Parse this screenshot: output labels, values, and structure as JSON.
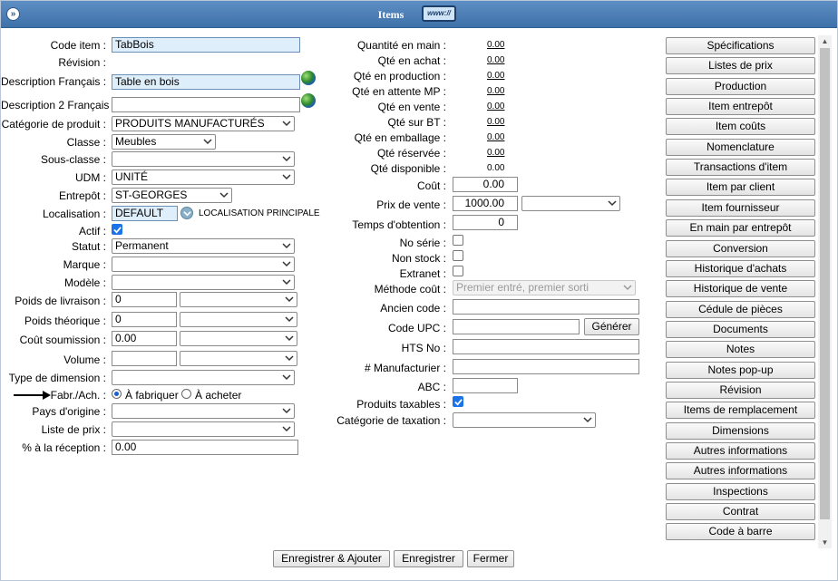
{
  "window": {
    "title": "Items",
    "badge": "www://",
    "menu_glyph": "»"
  },
  "left": {
    "code_item": {
      "label": "Code item :",
      "value": "TabBois"
    },
    "revision": {
      "label": "Révision :"
    },
    "description_fr": {
      "label": "Description Français :",
      "value": "Table en bois"
    },
    "description2_fr": {
      "label": "Description 2 Français :",
      "value": ""
    },
    "categorie": {
      "label": "Catégorie de produit :",
      "value": "PRODUITS MANUFACTURÉS"
    },
    "classe": {
      "label": "Classe :",
      "value": "Meubles"
    },
    "sous_classe": {
      "label": "Sous-classe :",
      "value": ""
    },
    "udm": {
      "label": "UDM :",
      "value": "UNITÉ"
    },
    "entrepot": {
      "label": "Entrepôt :",
      "value": "ST-GEORGES"
    },
    "localisation": {
      "label": "Localisation :",
      "value": "DEFAULT",
      "note": "LOCALISATION PRINCIPALE"
    },
    "actif": {
      "label": "Actif :",
      "checked": true
    },
    "statut": {
      "label": "Statut :",
      "value": "Permanent"
    },
    "marque": {
      "label": "Marque :",
      "value": ""
    },
    "modele": {
      "label": "Modèle :",
      "value": ""
    },
    "poids_livraison": {
      "label": "Poids de livraison :",
      "value": "0",
      "unit": ""
    },
    "poids_theorique": {
      "label": "Poids théorique :",
      "value": "0",
      "unit": ""
    },
    "cout_soumission": {
      "label": "Coût soumission :",
      "value": "0.00",
      "unit": ""
    },
    "volume": {
      "label": "Volume :",
      "value": "",
      "unit": ""
    },
    "type_dimension": {
      "label": "Type de dimension :",
      "value": ""
    },
    "fabr_ach": {
      "label": "Fabr./Ach. :",
      "opt1": "À fabriquer",
      "opt2": "À acheter",
      "selected": "À fabriquer"
    },
    "pays_origine": {
      "label": "Pays d'origine :",
      "value": ""
    },
    "liste_prix": {
      "label": "Liste de prix :",
      "value": ""
    },
    "pct_reception": {
      "label": "% à la réception :",
      "value": "0.00"
    }
  },
  "middle": {
    "qty": [
      {
        "label": "Quantité en main :",
        "value": "0.00",
        "link": true
      },
      {
        "label": "Qté en achat :",
        "value": "0.00",
        "link": true
      },
      {
        "label": "Qté en production :",
        "value": "0.00",
        "link": true
      },
      {
        "label": "Qté en attente MP :",
        "value": "0.00",
        "link": true
      },
      {
        "label": "Qté en vente :",
        "value": "0.00",
        "link": true
      },
      {
        "label": "Qté sur BT :",
        "value": "0.00",
        "link": true
      },
      {
        "label": "Qté en emballage :",
        "value": "0.00",
        "link": true
      },
      {
        "label": "Qté réservée :",
        "value": "0.00",
        "link": true
      },
      {
        "label": "Qté disponible :",
        "value": "0.00",
        "link": false
      }
    ],
    "cout": {
      "label": "Coût :",
      "value": "0.00"
    },
    "prix_vente": {
      "label": "Prix de vente :",
      "value": "1000.00",
      "select": ""
    },
    "temps_obtention": {
      "label": "Temps d'obtention :",
      "value": "0"
    },
    "no_serie": {
      "label": "No série :",
      "checked": false
    },
    "non_stock": {
      "label": "Non stock :",
      "checked": false
    },
    "extranet": {
      "label": "Extranet :",
      "checked": false
    },
    "methode_cout": {
      "label": "Méthode coût :",
      "value": "Premier entré, premier sorti"
    },
    "ancien_code": {
      "label": "Ancien code :",
      "value": ""
    },
    "code_upc": {
      "label": "Code UPC :",
      "value": "",
      "button": "Générer"
    },
    "hts_no": {
      "label": "HTS No :",
      "value": ""
    },
    "manufacturier": {
      "label": "# Manufacturier :",
      "value": ""
    },
    "abc": {
      "label": "ABC :",
      "value": ""
    },
    "produits_taxables": {
      "label": "Produits taxables :",
      "checked": true
    },
    "categorie_taxation": {
      "label": "Catégorie de taxation :",
      "value": ""
    }
  },
  "right_buttons": [
    "Spécifications",
    "Listes de prix",
    "Production",
    "Item entrepôt",
    "Item coûts",
    "Nomenclature",
    "Transactions d'item",
    "Item par client",
    "Item fournisseur",
    "En main par entrepôt",
    "Conversion",
    "Historique d'achats",
    "Historique de vente",
    "Cédule de pièces",
    "Documents",
    "Notes",
    "Notes pop-up",
    "Révision",
    "Items de remplacement",
    "Dimensions",
    "Autres informations",
    "Autres informations",
    "Inspections",
    "Contrat",
    "Code à barre"
  ],
  "bottom": {
    "save_add": "Enregistrer & Ajouter",
    "save": "Enregistrer",
    "close": "Fermer"
  },
  "colors": {
    "titlebar": "#4a7fb8",
    "highlight_input": "#dfeefb",
    "checkbox": "#1a73e8"
  }
}
